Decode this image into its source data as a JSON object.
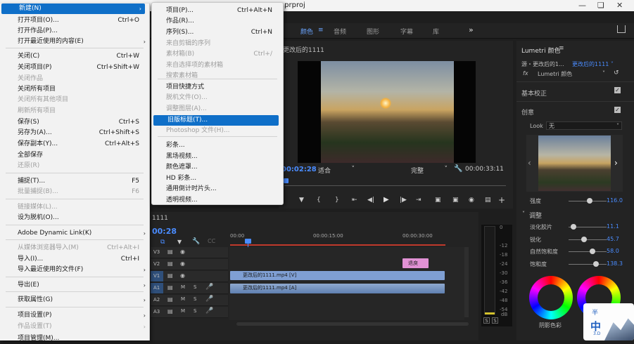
{
  "title_fragment": ".prproj",
  "workspace_tabs": [
    "颜色",
    "音频",
    "图形",
    "字幕",
    "库"
  ],
  "window_controls": [
    "minimize-icon",
    "maximize-icon",
    "close-icon"
  ],
  "program": {
    "header": "更改后的1111",
    "timecode_left": "00:02:28",
    "fit": "适合",
    "quality": "完整",
    "timecode_right": "00:00:33:11"
  },
  "lumetri": {
    "panel_title": "Lumetri 颜色",
    "source_prefix": "源・更改后的1...",
    "source_target": "更改后的1111",
    "effect": "Lumetri 颜色",
    "sections": [
      "基本校正",
      "创意"
    ],
    "look_label": "Look",
    "look_value": "无",
    "intensity_label": "强度",
    "intensity_value": "116.0",
    "adjust_label": "调整",
    "params": [
      {
        "label": "淡化胶片",
        "value": "11.1",
        "fraction": 0.05
      },
      {
        "label": "锐化",
        "value": "45.7",
        "fraction": 0.35
      },
      {
        "label": "自然饱和度",
        "value": "58.0",
        "fraction": 0.6
      },
      {
        "label": "饱和度",
        "value": "138.3",
        "fraction": 0.7
      }
    ],
    "wheel_label": "阴影色彩",
    "badge_top": "半",
    "badge_mid": "中",
    "badge_sub": "3.D"
  },
  "timeline": {
    "name": "1111",
    "timecode": "00:28",
    "ruler": [
      "00:00",
      "00:00:15:00",
      "00:00:30:00"
    ],
    "tracks": [
      {
        "id": "V3"
      },
      {
        "id": "V2"
      },
      {
        "id": "V1"
      },
      {
        "id": "A1"
      },
      {
        "id": "A2"
      },
      {
        "id": "A3"
      }
    ],
    "clip_video": "更改后的1111.mp4 [V]",
    "clip_audio": "更改后的1111.mp4 [A]",
    "clip_title": "退戾"
  },
  "meter": {
    "ticks": [
      "0",
      "-12",
      "-18",
      "-24",
      "-30",
      "-36",
      "-42",
      "-48",
      "-54",
      "dB"
    ],
    "solo": [
      "S",
      "S"
    ]
  },
  "file_menu": {
    "items": [
      {
        "label": "新建(N)",
        "shortcut": "",
        "arrow": true,
        "highlight": true,
        "disabled": false
      },
      {
        "label": "打开项目(O)...",
        "shortcut": "Ctrl+O",
        "arrow": false,
        "disabled": false
      },
      {
        "label": "打开作品(P)...",
        "shortcut": "",
        "arrow": false,
        "disabled": false
      },
      {
        "label": "打开最近使用的内容(E)",
        "shortcut": "",
        "arrow": true,
        "disabled": false
      },
      {
        "label": "关闭(C)",
        "shortcut": "Ctrl+W",
        "arrow": false,
        "disabled": false
      },
      {
        "label": "关闭项目(P)",
        "shortcut": "Ctrl+Shift+W",
        "arrow": false,
        "disabled": false
      },
      {
        "label": "关闭作品",
        "shortcut": "",
        "arrow": false,
        "disabled": true
      },
      {
        "label": "关闭所有项目",
        "shortcut": "",
        "arrow": false,
        "disabled": false
      },
      {
        "label": "关闭所有其他项目",
        "shortcut": "",
        "arrow": false,
        "disabled": true
      },
      {
        "label": "刷新所有项目",
        "shortcut": "",
        "arrow": false,
        "disabled": true
      },
      {
        "label": "保存(S)",
        "shortcut": "Ctrl+S",
        "arrow": false,
        "disabled": false
      },
      {
        "label": "另存为(A)...",
        "shortcut": "Ctrl+Shift+S",
        "arrow": false,
        "disabled": false
      },
      {
        "label": "保存副本(Y)...",
        "shortcut": "Ctrl+Alt+S",
        "arrow": false,
        "disabled": false
      },
      {
        "label": "全部保存",
        "shortcut": "",
        "arrow": false,
        "disabled": false
      },
      {
        "label": "还原(R)",
        "shortcut": "",
        "arrow": false,
        "disabled": true
      },
      {
        "label": "捕捉(T)...",
        "shortcut": "F5",
        "arrow": false,
        "disabled": false
      },
      {
        "label": "批量捕捉(B)...",
        "shortcut": "F6",
        "arrow": false,
        "disabled": true
      },
      {
        "label": "链接媒体(L)...",
        "shortcut": "",
        "arrow": false,
        "disabled": true
      },
      {
        "label": "设为脱机(O)...",
        "shortcut": "",
        "arrow": false,
        "disabled": false
      },
      {
        "label": "Adobe Dynamic Link(K)",
        "shortcut": "",
        "arrow": true,
        "disabled": false
      },
      {
        "label": "从媒体浏览器导入(M)",
        "shortcut": "Ctrl+Alt+I",
        "arrow": false,
        "disabled": true
      },
      {
        "label": "导入(I)...",
        "shortcut": "Ctrl+I",
        "arrow": false,
        "disabled": false
      },
      {
        "label": "导入最近使用的文件(F)",
        "shortcut": "",
        "arrow": true,
        "disabled": false
      },
      {
        "label": "导出(E)",
        "shortcut": "",
        "arrow": true,
        "disabled": false
      },
      {
        "label": "获取属性(G)",
        "shortcut": "",
        "arrow": true,
        "disabled": false
      },
      {
        "label": "项目设置(P)",
        "shortcut": "",
        "arrow": true,
        "disabled": false
      },
      {
        "label": "作品设置(T)",
        "shortcut": "",
        "arrow": true,
        "disabled": true
      },
      {
        "label": "项目管理(M)...",
        "shortcut": "",
        "arrow": false,
        "disabled": false
      }
    ]
  },
  "new_menu": {
    "items": [
      {
        "label": "项目(P)...",
        "shortcut": "Ctrl+Alt+N",
        "disabled": false
      },
      {
        "label": "作品(R)...",
        "shortcut": "",
        "disabled": false
      },
      {
        "label": "序列(S)...",
        "shortcut": "Ctrl+N",
        "disabled": false
      },
      {
        "label": "来自剪辑的序列",
        "shortcut": "",
        "disabled": true
      },
      {
        "label": "素材箱(B)",
        "shortcut": "Ctrl+/",
        "disabled": true
      },
      {
        "label": "来自选择项的素材箱",
        "shortcut": "",
        "disabled": true
      },
      {
        "label": "搜索素材箱",
        "shortcut": "",
        "disabled": true
      },
      {
        "label": "项目快捷方式",
        "shortcut": "",
        "disabled": false
      },
      {
        "label": "脱机文件(O)...",
        "shortcut": "",
        "disabled": true
      },
      {
        "label": "调整图层(A)...",
        "shortcut": "",
        "disabled": true
      },
      {
        "label": "旧版标题(T)...",
        "shortcut": "",
        "disabled": false,
        "highlight": true
      },
      {
        "label": "Photoshop 文件(H)...",
        "shortcut": "",
        "disabled": true
      },
      {
        "label": "彩条...",
        "shortcut": "",
        "disabled": false
      },
      {
        "label": "黑场视频...",
        "shortcut": "",
        "disabled": false
      },
      {
        "label": "颜色遮罩...",
        "shortcut": "",
        "disabled": false
      },
      {
        "label": "HD 彩条...",
        "shortcut": "",
        "disabled": false
      },
      {
        "label": "通用倒计时片头...",
        "shortcut": "",
        "disabled": false
      },
      {
        "label": "透明视频...",
        "shortcut": "",
        "disabled": false
      }
    ]
  }
}
